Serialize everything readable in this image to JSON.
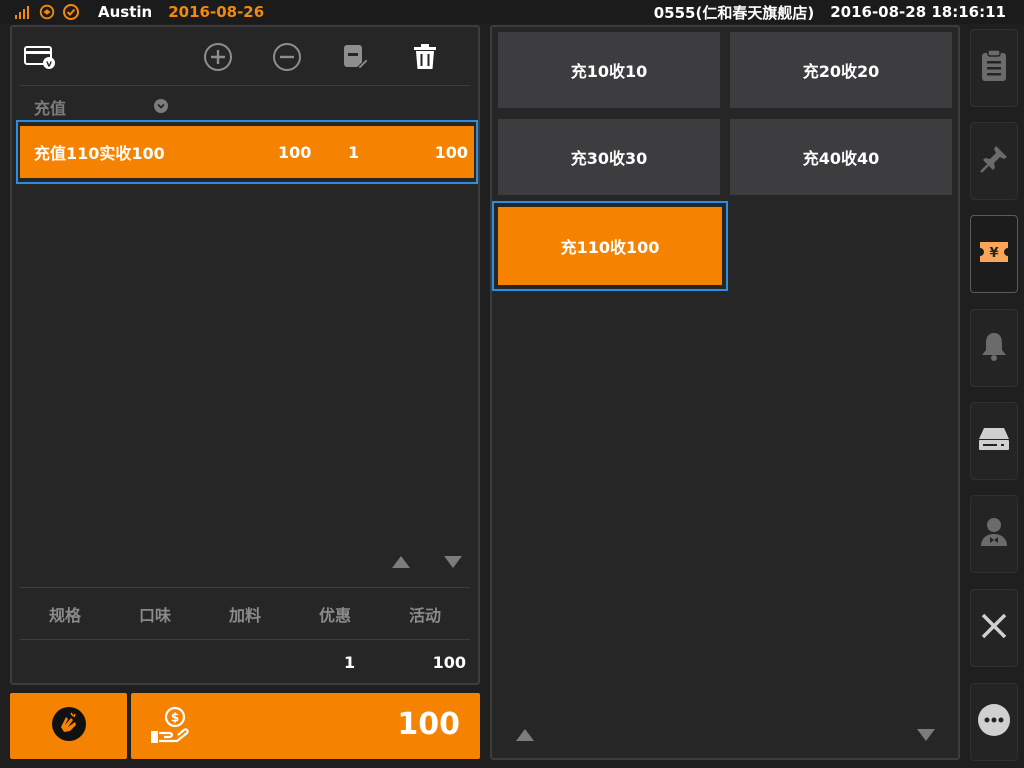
{
  "status_bar": {
    "user": "Austin",
    "business_date": "2016-08-26",
    "store": "0555(仁和春天旗舰店)",
    "datetime": "2016-08-28 18:16:11",
    "icons": [
      "signal-icon",
      "sync-icon",
      "check-circle-icon"
    ],
    "accent_color": "#f28a0f"
  },
  "order_panel": {
    "toolbar_icons": [
      "member-card-icon",
      "add-icon",
      "remove-icon",
      "edit-icon",
      "delete-icon"
    ],
    "group_label": "充值",
    "selected_item": {
      "name": "充值110实收100",
      "price": "100",
      "qty": "1",
      "total": "100"
    },
    "attr_tabs": [
      "规格",
      "口味",
      "加料",
      "优惠",
      "活动"
    ],
    "summary": {
      "qty": "1",
      "total": "100"
    }
  },
  "actions": {
    "pay_amount": "100",
    "primary_color": "#f58200"
  },
  "recharge_options": {
    "options": [
      "充10收10",
      "充20收20",
      "充30收30",
      "充40收40"
    ],
    "selected": "充110收100"
  },
  "sidebar": {
    "items": [
      "clipboard-icon",
      "pin-icon",
      "coupon-icon",
      "bell-icon",
      "cash-drawer-icon",
      "waiter-icon",
      "close-icon",
      "more-icon"
    ],
    "active_item": "coupon-icon"
  }
}
